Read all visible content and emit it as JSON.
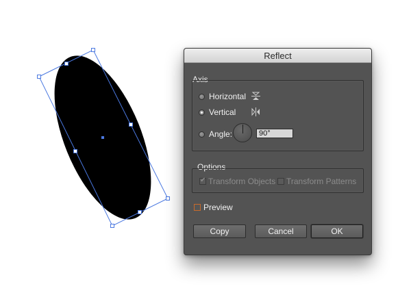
{
  "dialog": {
    "title": "Reflect",
    "axis": {
      "group_label": "Axis",
      "horizontal_label": "Horizontal",
      "vertical_label": "Vertical",
      "angle_label": "Angle:",
      "angle_value": "90°",
      "selected": "vertical"
    },
    "options": {
      "group_label": "Options",
      "transform_objects_label": "Transform Objects",
      "transform_patterns_label": "Transform Patterns"
    },
    "preview_label": "Preview",
    "buttons": {
      "copy": "Copy",
      "cancel": "Cancel",
      "ok": "OK"
    }
  },
  "colors": {
    "dialog_bg": "#535353",
    "selection": "#3f6bd8",
    "shape_fill": "#000000"
  }
}
